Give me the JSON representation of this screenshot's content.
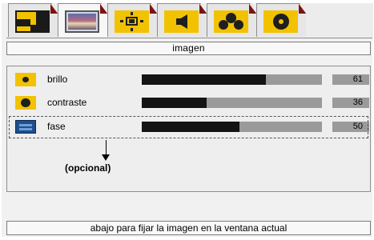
{
  "tabs": [
    {
      "icon": "window-layout-icon",
      "active": false
    },
    {
      "icon": "image-icon",
      "active": true
    },
    {
      "icon": "screen-position-icon",
      "active": false
    },
    {
      "icon": "audio-icon",
      "active": false
    },
    {
      "icon": "color-icon",
      "active": false
    },
    {
      "icon": "settings-icon",
      "active": false
    }
  ],
  "section_title": "imagen",
  "rows": [
    {
      "label": "brillo",
      "value": "61",
      "level_percent": 69
    },
    {
      "label": "contraste",
      "value": "36",
      "level_percent": 36
    },
    {
      "label": "fase",
      "value": "50",
      "level_percent": 54
    }
  ],
  "optional_note": "(opcional)",
  "hint": "abajo para fijar la imagen en la ventana actual",
  "colors": {
    "accent_yellow": "#f2c200",
    "bar_fill": "#141414",
    "bar_track": "#9a9a9a",
    "tab_corner": "#7a1414"
  }
}
